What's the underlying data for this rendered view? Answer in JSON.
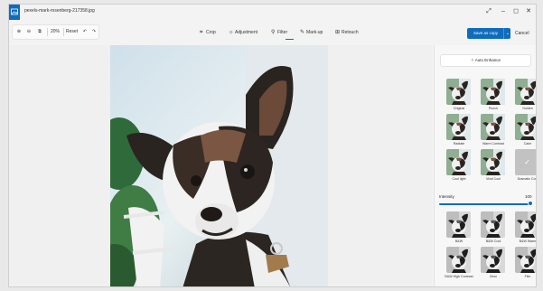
{
  "window": {
    "title": "pexels-mark-rosenberg-217358.jpg",
    "controls": {
      "expand": "⤢",
      "minimize": "–",
      "maximize": "◻",
      "close": "✕"
    }
  },
  "toolbar": {
    "zoom_in": "⊕",
    "zoom_out": "⊖",
    "fit": "⧉",
    "zoom_level": "20%",
    "reset": "Reset",
    "undo": "↶",
    "redo": "↷",
    "tools": [
      {
        "icon": "⌗",
        "label": "Crop",
        "icon_name": "crop-icon"
      },
      {
        "icon": "☼",
        "label": "Adjustment",
        "icon_name": "adjustment-icon"
      },
      {
        "icon": "⚲",
        "label": "Filter",
        "icon_name": "filter-icon"
      },
      {
        "icon": "✎",
        "label": "Mark-up",
        "icon_name": "markup-icon"
      },
      {
        "icon": "⊞",
        "label": "Retouch",
        "icon_name": "retouch-icon"
      }
    ],
    "active_tool": "Filter",
    "save_label": "Save as copy",
    "save_dropdown": "⌄",
    "cancel_label": "Cancel"
  },
  "panel": {
    "auto_enhance_label": "Auto Enhance",
    "filters_top": [
      "Original",
      "Punch",
      "Golden",
      "Radiate",
      "Warm Contrast",
      "Calm",
      "Cool light",
      "Vivid Cool",
      "Dramatic Cool"
    ],
    "intensity_label": "Intensity",
    "intensity_value": "100",
    "intensity_level": 1.0,
    "filters_bottom": [
      "B&W",
      "B&W Cool",
      "B&W Warm",
      "B&W High Contrast",
      "Zeon",
      "Film"
    ]
  },
  "colors": {
    "accent": "#0f6cbd",
    "background": "#f3f3f3"
  }
}
